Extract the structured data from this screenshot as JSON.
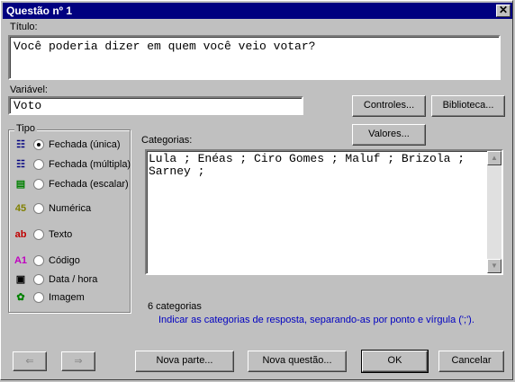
{
  "window": {
    "title": "Questão nº 1",
    "close_glyph": "✕"
  },
  "titulo": {
    "label": "Título:",
    "value": "Você poderia dizer em quem você veio votar?"
  },
  "variavel": {
    "label": "Variável:",
    "value": "Voto"
  },
  "buttons": {
    "controles": "Controles...",
    "biblioteca": "Biblioteca...",
    "valores": "Valores...",
    "prev": "⇐",
    "next": "⇒",
    "nova_parte": "Nova parte...",
    "nova_questao": "Nova questão...",
    "ok": "OK",
    "cancelar": "Cancelar"
  },
  "tipo": {
    "label": "Tipo",
    "options": [
      {
        "label": "Fechada (única)",
        "icon": "list-single-icon",
        "glyph": "☷",
        "selected": true
      },
      {
        "label": "Fechada (múltipla)",
        "icon": "list-multiple-icon",
        "glyph": "☷",
        "selected": false
      },
      {
        "label": "Fechada (escalar)",
        "icon": "scale-icon",
        "glyph": "▤",
        "selected": false
      },
      {
        "label": "Numérica",
        "icon": "numeric-icon",
        "glyph": "45",
        "selected": false
      },
      {
        "label": "Texto",
        "icon": "text-icon",
        "glyph": "ab",
        "selected": false
      },
      {
        "label": "Código",
        "icon": "code-icon",
        "glyph": "A1",
        "selected": false
      },
      {
        "label": "Data / hora",
        "icon": "calendar-icon",
        "glyph": "▣",
        "selected": false
      },
      {
        "label": "Imagem",
        "icon": "image-icon",
        "glyph": "✿",
        "selected": false
      }
    ]
  },
  "categorias": {
    "label": "Categorias:",
    "value": "Lula ; Enéas ; Ciro Gomes ; Maluf ; Brizola ;\nSarney ;",
    "count_text": "6 categorias",
    "hint": "Indicar as categorias de resposta, separando-as por ponto e vírgula (';')."
  },
  "colors": {
    "titlebar": "#000080",
    "hint": "#0000c0"
  }
}
